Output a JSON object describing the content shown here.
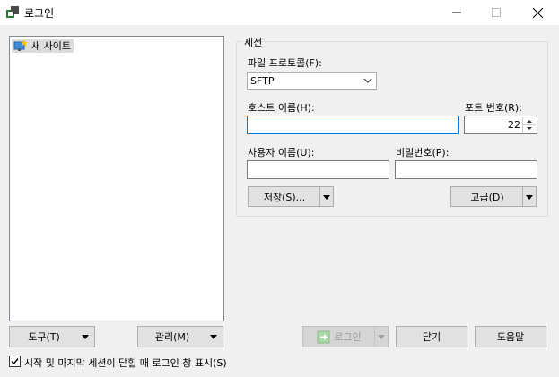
{
  "window": {
    "title": "로그인",
    "controls": {
      "minimize": "—",
      "maximize": "☐",
      "close": "✕"
    }
  },
  "site_list": {
    "items": [
      {
        "label": "새 사이트",
        "icon": "new-site-icon"
      }
    ]
  },
  "session": {
    "group_label": "세션",
    "protocol_label": "파일 프로토콜(F):",
    "protocol_value": "SFTP",
    "host_label": "호스트 이름(H):",
    "host_value": "",
    "port_label": "포트 번호(R):",
    "port_value": "22",
    "user_label": "사용자 이름(U):",
    "user_value": "",
    "password_label": "비밀번호(P):",
    "password_value": "",
    "save_label": "저장(S)...",
    "advanced_label": "고급(D)"
  },
  "bottom": {
    "tools_label": "도구(T)",
    "manage_label": "관리(M)",
    "login_label": "로그인",
    "close_label": "닫기",
    "help_label": "도움말",
    "checkbox_label": "시작 및 마지막 세션이 닫힐 때 로그인 창 표시(S)",
    "checkbox_checked": true
  },
  "colors": {
    "accent": "#0078d7",
    "background": "#f0f0f0"
  }
}
